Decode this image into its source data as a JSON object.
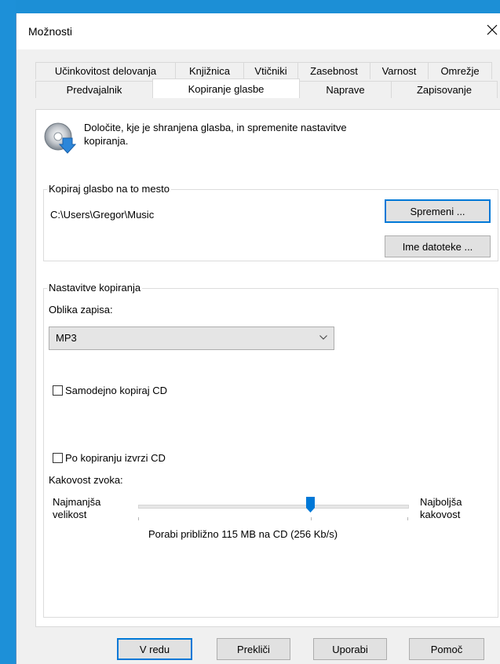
{
  "window": {
    "title": "Možnosti"
  },
  "tabs_row1": [
    "Učinkovitost delovanja",
    "Knjižnica",
    "Vtičniki",
    "Zasebnost",
    "Varnost",
    "Omrežje"
  ],
  "tabs_row2": [
    "Predvajalnik",
    "Kopiranje glasbe",
    "Naprave",
    "Zapisovanje"
  ],
  "selected_tab": "Kopiranje glasbe",
  "intro": {
    "line1": "Določite, kje je shranjena glasba, in spremenite nastavitve",
    "line2": "kopiranja."
  },
  "location_group": {
    "label": "Kopiraj glasbo na to mesto",
    "path": "C:\\Users\\Gregor\\Music",
    "change_button": "Spremeni ...",
    "filename_button": "Ime datoteke ..."
  },
  "settings_group": {
    "label": "Nastavitve kopiranja",
    "format_label": "Oblika zapisa:",
    "format_value": "MP3",
    "auto_rip_label": "Samodejno kopiraj CD",
    "auto_rip_checked": false,
    "eject_label": "Po kopiranju izvrzi CD",
    "eject_checked": false,
    "quality_label": "Kakovost zvoka:",
    "min_label_line1": "Najmanjša",
    "min_label_line2": "velikost",
    "max_label_line1": "Najboljša",
    "max_label_line2": "kakovost",
    "quality_position": 0.64,
    "quality_info": "Porabi približno 115 MB na CD (256 Kb/s)"
  },
  "buttons": {
    "ok": "V redu",
    "cancel": "Prekliči",
    "apply": "Uporabi",
    "help": "Pomoč"
  },
  "colors": {
    "accent": "#0078d7",
    "desktop": "#1c8fd6"
  }
}
